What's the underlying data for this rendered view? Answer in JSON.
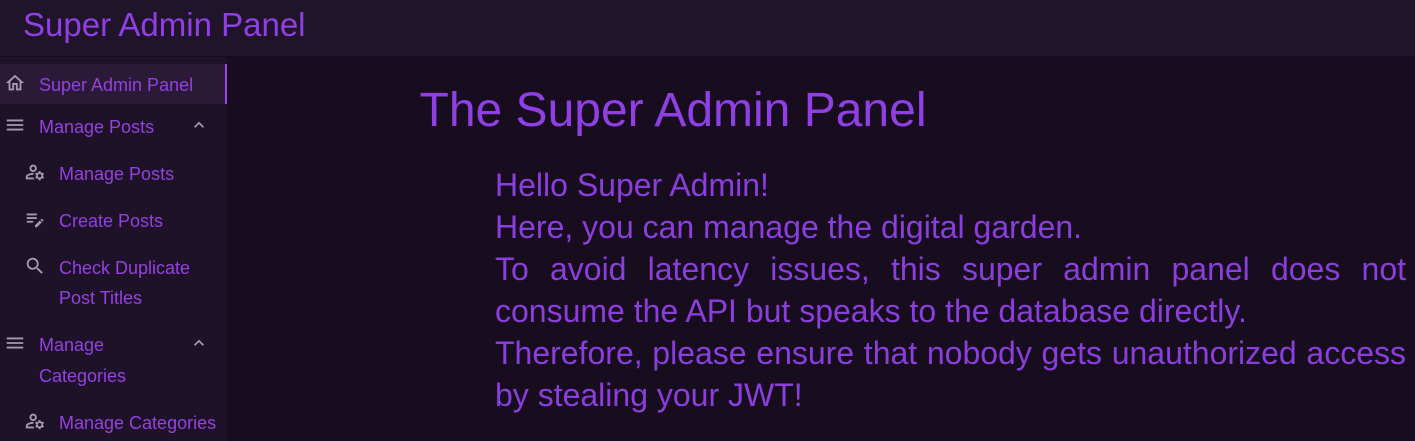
{
  "header": {
    "title": "Super Admin Panel"
  },
  "sidebar": {
    "items": [
      {
        "label": "Super Admin Panel",
        "icon": "home-icon",
        "active": true
      },
      {
        "label": "Manage Posts",
        "icon": "menu-icon",
        "expanded": true
      },
      {
        "label": "Manage Posts",
        "icon": "user-settings-icon"
      },
      {
        "label": "Create Posts",
        "icon": "edit-list-icon"
      },
      {
        "label_line1": "Check Duplicate",
        "label_line2": "Post Titles",
        "icon": "search-icon"
      },
      {
        "label_line1": "Manage",
        "label_line2": "Categories",
        "icon": "menu-icon",
        "expanded": true
      },
      {
        "label": "Manage Categories",
        "icon": "user-settings-icon"
      }
    ]
  },
  "main": {
    "title": "The Super Admin Panel",
    "paragraphs": [
      "Hello Super Admin!",
      "Here, you can manage the digital garden.",
      "To avoid latency issues, this super admin panel does not consume the API but speaks to the database directly.",
      "Therefore, please ensure that nobody gets unauthorized access by stealing your JWT!"
    ]
  },
  "colors": {
    "accent": "#8f3fe3",
    "background": "#170d1f",
    "sidebar": "#1e1229",
    "topbar": "#20142b",
    "icon": "#a59bb0"
  }
}
